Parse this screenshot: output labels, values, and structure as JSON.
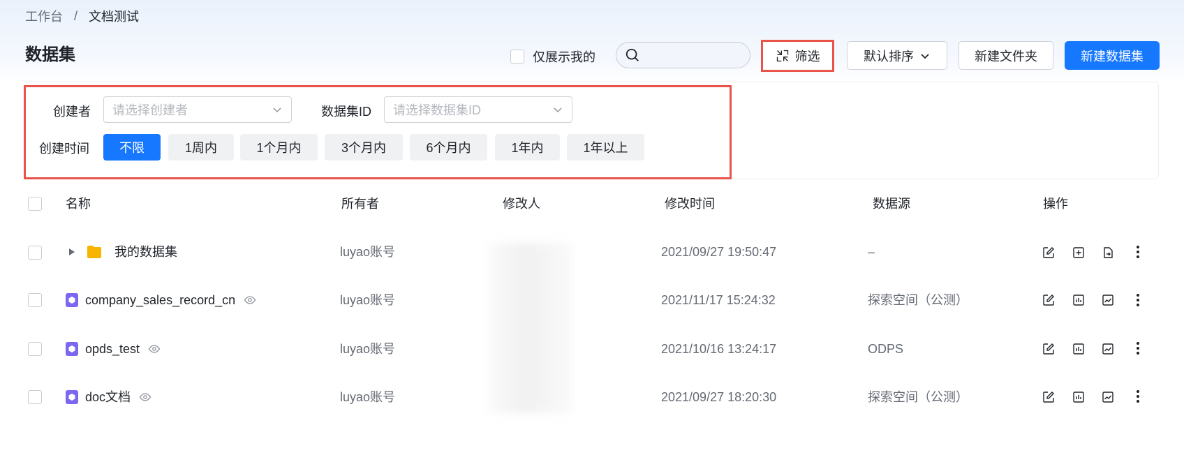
{
  "breadcrumb": {
    "root": "工作台",
    "separator": "/",
    "current": "文档测试"
  },
  "page_title": "数据集",
  "toolbar": {
    "only_mine_label": "仅展示我的",
    "search_placeholder": "",
    "filter_label": "筛选",
    "sort_label": "默认排序",
    "new_folder_label": "新建文件夹",
    "new_dataset_label": "新建数据集"
  },
  "filters": {
    "creator_label": "创建者",
    "creator_placeholder": "请选择创建者",
    "dataset_id_label": "数据集ID",
    "dataset_id_placeholder": "请选择数据集ID",
    "create_time_label": "创建时间",
    "time_options": [
      "不限",
      "1周内",
      "1个月内",
      "3个月内",
      "6个月内",
      "1年内",
      "1年以上"
    ],
    "selected_time": "不限"
  },
  "table": {
    "headers": {
      "name": "名称",
      "owner": "所有者",
      "modifier": "修改人",
      "modified_time": "修改时间",
      "source": "数据源",
      "actions": "操作"
    },
    "rows": [
      {
        "type": "folder",
        "name": "我的数据集",
        "owner": "luyao账号",
        "modified_time": "2021/09/27 19:50:47",
        "source": "–"
      },
      {
        "type": "dataset",
        "name": "company_sales_record_cn",
        "owner": "luyao账号",
        "modified_time": "2021/11/17 15:24:32",
        "source": "探索空间（公测）"
      },
      {
        "type": "dataset",
        "name": "opds_test",
        "owner": "luyao账号",
        "modified_time": "2021/10/16 13:24:17",
        "source": "ODPS"
      },
      {
        "type": "dataset",
        "name": "doc文档",
        "owner": "luyao账号",
        "modified_time": "2021/09/27 18:20:30",
        "source": "探索空间（公测）"
      }
    ]
  },
  "colors": {
    "primary": "#1677ff",
    "highlight": "#e8544a",
    "folder": "#f7b500",
    "dataset_icon": "#7b68ee"
  }
}
